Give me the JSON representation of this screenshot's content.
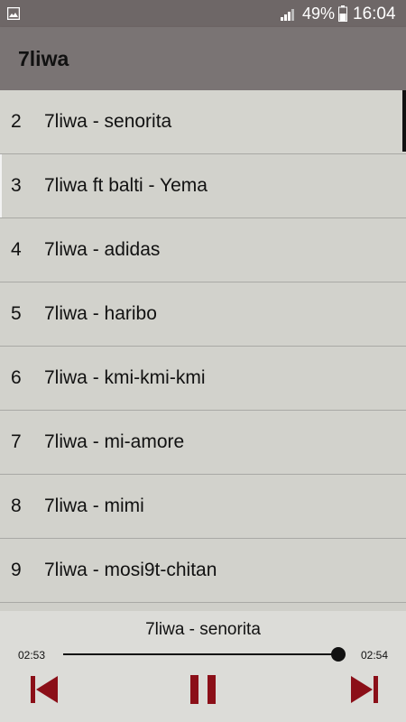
{
  "status_bar": {
    "battery": "49%",
    "time": "16:04"
  },
  "app_bar": {
    "title": "7liwa"
  },
  "songs": [
    {
      "number": "2",
      "title": "7liwa - senorita"
    },
    {
      "number": "3",
      "title": "7liwa ft balti - Yema"
    },
    {
      "number": "4",
      "title": "7liwa - adidas"
    },
    {
      "number": "5",
      "title": "7liwa - haribo"
    },
    {
      "number": "6",
      "title": "7liwa - kmi-kmi-kmi"
    },
    {
      "number": "7",
      "title": "7liwa - mi-amore"
    },
    {
      "number": "8",
      "title": "7liwa - mimi"
    },
    {
      "number": "9",
      "title": "7liwa - mosi9t-chitan"
    }
  ],
  "player": {
    "now_playing": "7liwa - senorita",
    "elapsed": "02:53",
    "total": "02:54",
    "progress": 0.994,
    "accent_color": "#8b0f18"
  }
}
